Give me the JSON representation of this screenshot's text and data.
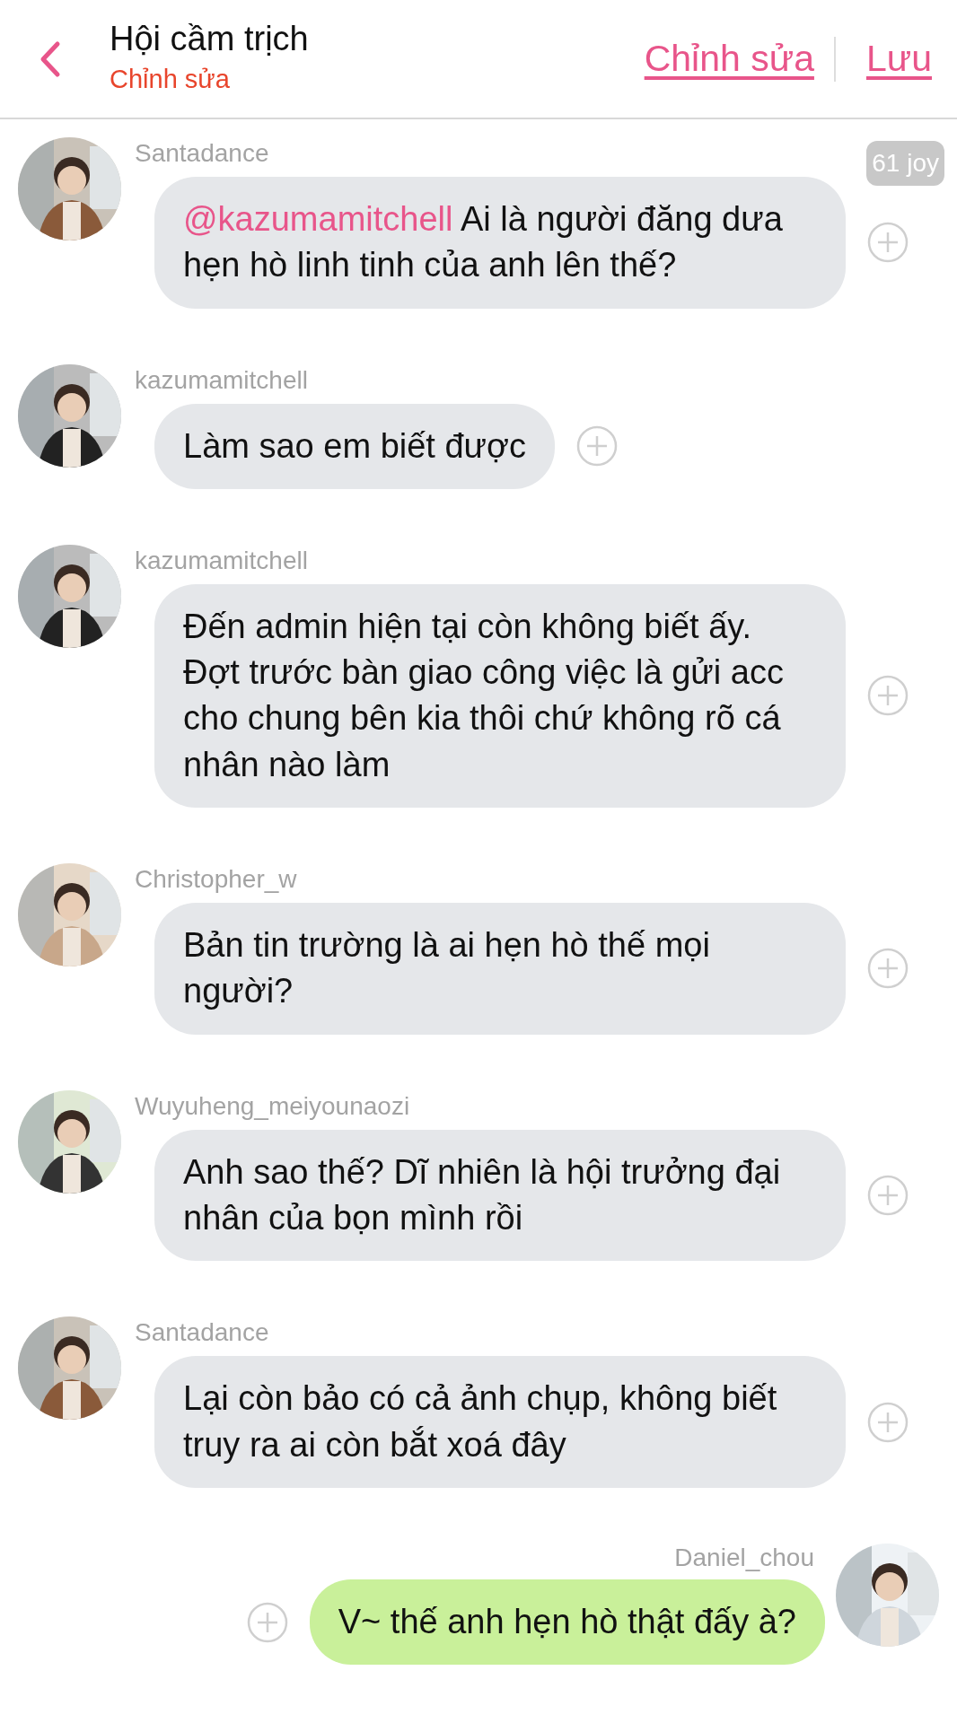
{
  "header": {
    "title": "Hội cầm trịch",
    "subtitle": "Chỉnh sửa",
    "actions": [
      "Chỉnh sửa",
      "Lưu"
    ]
  },
  "badge": "61 joy",
  "messages": [
    {
      "kind": "incoming",
      "author": "Santadance",
      "mention": "@kazumamitchell",
      "text": "Ai là người đăng dưa hẹn hò linh tinh của anh lên thế?"
    },
    {
      "kind": "incoming",
      "author": "kazumamitchell",
      "text": "Làm sao em biết được"
    },
    {
      "kind": "incoming",
      "author": "kazumamitchell",
      "text": "Đến admin hiện tại còn không biết ấy. Đợt trước bàn giao công việc là gửi acc cho chung bên kia thôi chứ không rõ cá nhân nào làm"
    },
    {
      "kind": "incoming",
      "author": "Christopher_w",
      "text": "Bản tin trường là ai hẹn hò thế mọi người?"
    },
    {
      "kind": "incoming",
      "author": "Wuyuheng_meiyounaozi",
      "text": "Anh sao thế? Dĩ nhiên là hội trưởng đại nhân của bọn mình rồi"
    },
    {
      "kind": "incoming",
      "author": "Santadance",
      "text": "Lại còn bảo có cả ảnh chụp, không biết truy ra ai còn bắt xoá đây"
    },
    {
      "kind": "outgoing",
      "author": "Daniel_chou",
      "text": "V~ thế anh hẹn hò thật đấy à?"
    }
  ]
}
